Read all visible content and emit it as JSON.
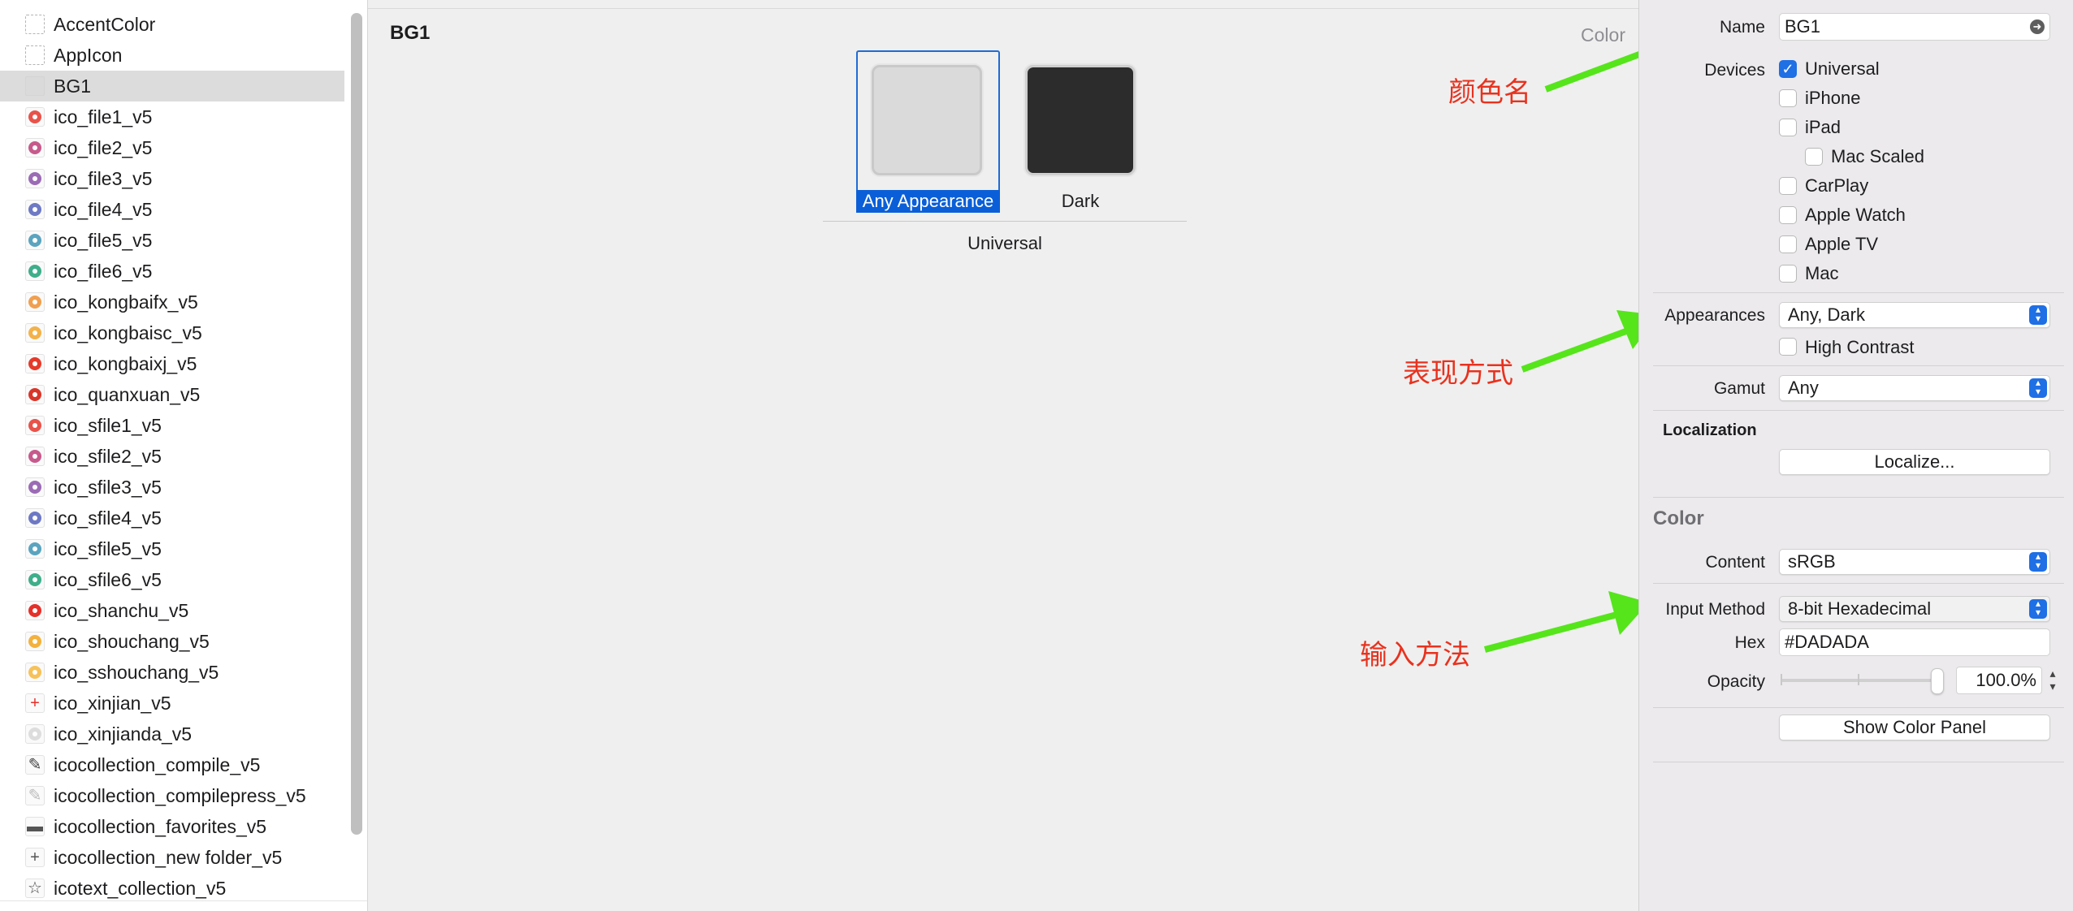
{
  "sidebar": {
    "items": [
      {
        "label": "AccentColor",
        "icon": "dashed-placeholder-icon",
        "kind": "dashed"
      },
      {
        "label": "AppIcon",
        "icon": "dashed-placeholder-icon",
        "kind": "dashed"
      },
      {
        "label": "BG1",
        "icon": "color-swatch-icon",
        "kind": "swatch",
        "selected": true
      },
      {
        "label": "ico_file1_v5",
        "icon": "file-dot-icon",
        "kind": "dot",
        "color": "#e8534a"
      },
      {
        "label": "ico_file2_v5",
        "icon": "file-dot-icon",
        "kind": "dot",
        "color": "#c75a8c"
      },
      {
        "label": "ico_file3_v5",
        "icon": "file-dot-icon",
        "kind": "dot",
        "color": "#9b6bb5"
      },
      {
        "label": "ico_file4_v5",
        "icon": "file-dot-icon",
        "kind": "dot",
        "color": "#6d79c4"
      },
      {
        "label": "ico_file5_v5",
        "icon": "file-dot-icon",
        "kind": "dot",
        "color": "#5aa4bf"
      },
      {
        "label": "ico_file6_v5",
        "icon": "file-dot-icon",
        "kind": "dot",
        "color": "#3fae8a"
      },
      {
        "label": "ico_kongbaifx_v5",
        "icon": "illustration-icon",
        "kind": "dot",
        "color": "#f0a050"
      },
      {
        "label": "ico_kongbaisc_v5",
        "icon": "illustration-icon",
        "kind": "dot",
        "color": "#f3b24a"
      },
      {
        "label": "ico_kongbaixj_v5",
        "icon": "illustration-icon",
        "kind": "dot",
        "color": "#e53a2a"
      },
      {
        "label": "ico_quanxuan_v5",
        "icon": "check-circle-icon",
        "kind": "dot",
        "color": "#d9362a"
      },
      {
        "label": "ico_sfile1_v5",
        "icon": "file-dot-icon",
        "kind": "dot",
        "color": "#e8534a"
      },
      {
        "label": "ico_sfile2_v5",
        "icon": "file-dot-icon",
        "kind": "dot",
        "color": "#c75a8c"
      },
      {
        "label": "ico_sfile3_v5",
        "icon": "file-dot-icon",
        "kind": "dot",
        "color": "#9b6bb5"
      },
      {
        "label": "ico_sfile4_v5",
        "icon": "file-dot-icon",
        "kind": "dot",
        "color": "#6d79c4"
      },
      {
        "label": "ico_sfile5_v5",
        "icon": "file-dot-icon",
        "kind": "dot",
        "color": "#5aa4bf"
      },
      {
        "label": "ico_sfile6_v5",
        "icon": "file-dot-icon",
        "kind": "dot",
        "color": "#3fae8a"
      },
      {
        "label": "ico_shanchu_v5",
        "icon": "minus-circle-icon",
        "kind": "dot",
        "color": "#e5302a"
      },
      {
        "label": "ico_shouchang_v5",
        "icon": "star-circle-icon",
        "kind": "dot",
        "color": "#f3b23e"
      },
      {
        "label": "ico_sshouchang_v5",
        "icon": "star-circle-icon",
        "kind": "dot",
        "color": "#f6c25a"
      },
      {
        "label": "ico_xinjian_v5",
        "icon": "plus-icon",
        "kind": "glyph",
        "glyph": "+",
        "color": "#e5302a"
      },
      {
        "label": "ico_xinjianda_v5",
        "icon": "circle-icon",
        "kind": "dot",
        "color": "#dddddd"
      },
      {
        "label": "icocollection_compile_v5",
        "icon": "pencil-icon",
        "kind": "glyph",
        "glyph": "✎",
        "color": "#444444"
      },
      {
        "label": "icocollection_compilepress_v5",
        "icon": "pencil-icon",
        "kind": "glyph",
        "glyph": "✎",
        "color": "#bbbbbb"
      },
      {
        "label": "icocollection_favorites_v5",
        "icon": "folder-icon",
        "kind": "glyph",
        "glyph": "▬",
        "color": "#555555"
      },
      {
        "label": "icocollection_new folder_v5",
        "icon": "plus-icon",
        "kind": "glyph",
        "glyph": "+",
        "color": "#555555"
      },
      {
        "label": "icotext_collection_v5",
        "icon": "star-icon",
        "kind": "glyph",
        "glyph": "☆",
        "color": "#444444"
      }
    ]
  },
  "editor": {
    "title": "BG1",
    "type_label": "Color",
    "wells": [
      {
        "label": "Any Appearance",
        "color": "#DADADA",
        "selected": true
      },
      {
        "label": "Dark",
        "color": "#2C2C2C",
        "selected": false
      }
    ],
    "slot_caption": "Universal"
  },
  "annotations": {
    "name": "颜色名",
    "appearance": "表现方式",
    "input_method": "输入方法",
    "arrow_color": "#55e51a",
    "text_color": "#e8321e"
  },
  "inspector": {
    "name_label": "Name",
    "name_value": "BG1",
    "devices_label": "Devices",
    "devices": [
      {
        "label": "Universal",
        "checked": true
      },
      {
        "label": "iPhone",
        "checked": false
      },
      {
        "label": "iPad",
        "checked": false
      },
      {
        "label": "Mac Scaled",
        "checked": false
      },
      {
        "label": "CarPlay",
        "checked": false
      },
      {
        "label": "Apple Watch",
        "checked": false
      },
      {
        "label": "Apple TV",
        "checked": false
      },
      {
        "label": "Mac",
        "checked": false
      }
    ],
    "appearances_label": "Appearances",
    "appearances_value": "Any, Dark",
    "high_contrast_label": "High Contrast",
    "high_contrast_checked": false,
    "gamut_label": "Gamut",
    "gamut_value": "Any",
    "localization_header": "Localization",
    "localize_button": "Localize...",
    "color_header": "Color",
    "content_label": "Content",
    "content_value": "sRGB",
    "input_method_label": "Input Method",
    "input_method_value": "8-bit Hexadecimal",
    "hex_label": "Hex",
    "hex_value": "#DADADA",
    "opacity_label": "Opacity",
    "opacity_value": "100.0%",
    "opacity_fraction": 1.0,
    "show_color_panel_button": "Show Color Panel"
  }
}
